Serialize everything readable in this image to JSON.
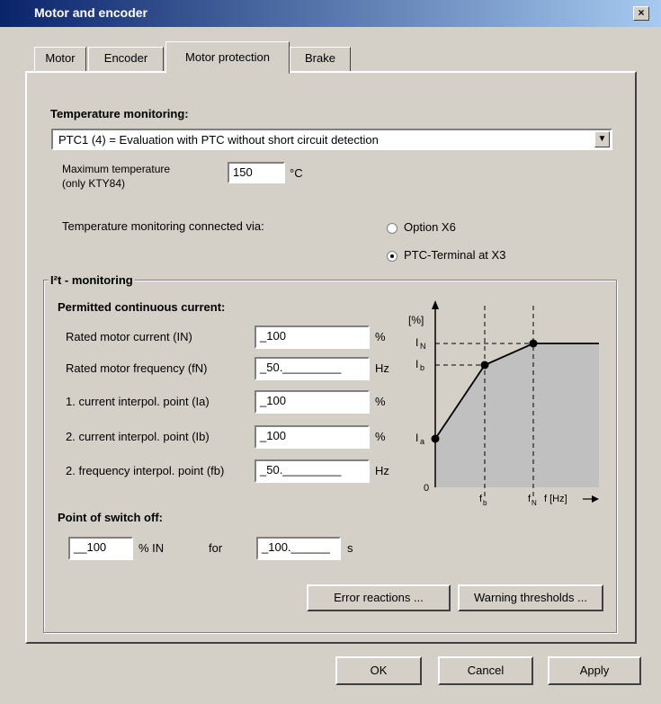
{
  "window": {
    "title": "Motor and encoder",
    "close": "×"
  },
  "tabs": [
    "Motor",
    "Encoder",
    "Motor protection",
    "Brake"
  ],
  "temperature": {
    "heading": "Temperature monitoring:",
    "mode": "PTC1 (4) = Evaluation with PTC without short circuit detection",
    "max_label_1": "Maximum temperature",
    "max_label_2": "(only KTY84)",
    "max_value": "150",
    "max_unit": "°C",
    "connected_label": "Temperature monitoring connected via:",
    "option_x6": "Option X6",
    "option_x3": "PTC-Terminal at X3",
    "selected": "option_x3"
  },
  "i2t": {
    "group_label": "I²t - monitoring",
    "permitted_heading": "Permitted continuous current:",
    "rows": [
      {
        "label": "Rated motor current (IN)",
        "value": "_100",
        "unit": "%"
      },
      {
        "label": "Rated motor frequency (fN)",
        "value": "_50._________",
        "unit": "Hz"
      },
      {
        "label": "1. current interpol. point (Ia)",
        "value": "_100",
        "unit": "%"
      },
      {
        "label": "2. current interpol. point (Ib)",
        "value": "_100",
        "unit": "%"
      },
      {
        "label": "2. frequency interpol. point (fb)",
        "value": "_50._________",
        "unit": "Hz"
      }
    ],
    "switch_off_heading": "Point of switch off:",
    "switch_off_value": "__100",
    "switch_off_unit": "% IN",
    "for_label": "for",
    "time_value": "_100.______",
    "time_unit": "s",
    "error_button": "Error reactions ...",
    "warning_button": "Warning thresholds ..."
  },
  "graph": {
    "y_unit": "[%]",
    "y_labels": {
      "IN": "I",
      "IN_sub": "N",
      "Ib": "I",
      "Ib_sub": "b",
      "Ia": "I",
      "Ia_sub": "a",
      "zero": "0"
    },
    "x_labels": {
      "fb": "f",
      "fb_sub": "b",
      "fN": "f",
      "fN_sub": "N",
      "axis": "f [Hz]"
    },
    "fill_color": "#c0c0c0"
  },
  "footer": {
    "ok": "OK",
    "cancel": "Cancel",
    "apply": "Apply"
  }
}
